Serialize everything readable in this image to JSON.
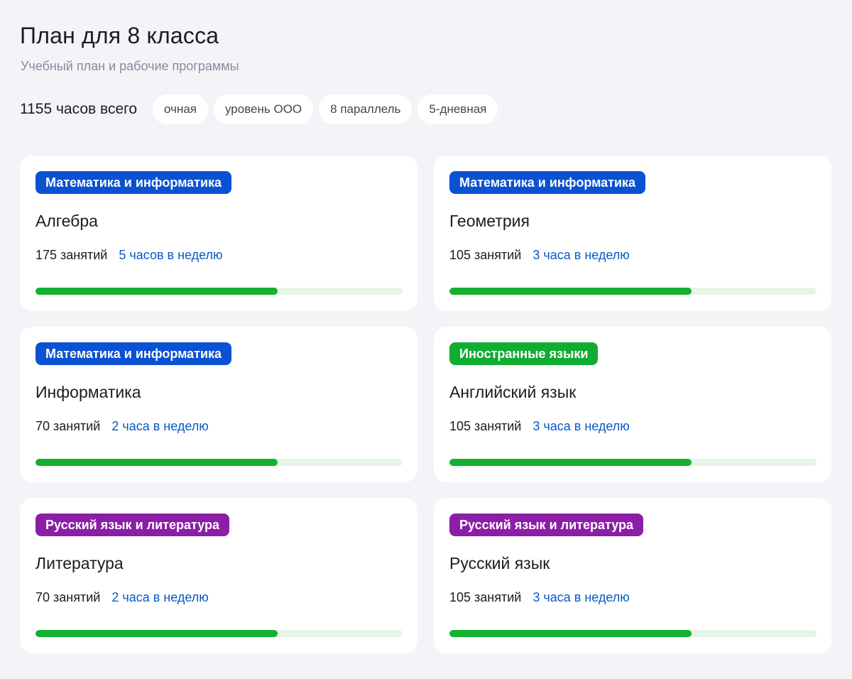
{
  "header": {
    "title": "План для 8 класса",
    "subtitle": "Учебный план и рабочие программы"
  },
  "summary": {
    "total_hours": "1155 часов всего",
    "chips": [
      "очная",
      "уровень ООО",
      "8 параллель",
      "5-дневная"
    ]
  },
  "colors": {
    "math": "#0a52d1",
    "languages": "#10ad32",
    "russian": "#8b1ea6",
    "progress": "#12b12f"
  },
  "subjects": [
    {
      "category": "Математика и информатика",
      "category_color": "#0a52d1",
      "name": "Алгебра",
      "lessons": "175 занятий",
      "weekly": "5 часов в неделю",
      "progress": 0.66
    },
    {
      "category": "Математика и информатика",
      "category_color": "#0a52d1",
      "name": "Геометрия",
      "lessons": "105 занятий",
      "weekly": "3 часа в неделю",
      "progress": 0.66
    },
    {
      "category": "Математика и информатика",
      "category_color": "#0a52d1",
      "name": "Информатика",
      "lessons": "70 занятий",
      "weekly": "2 часа в неделю",
      "progress": 0.66
    },
    {
      "category": "Иностранные языки",
      "category_color": "#10ad32",
      "name": "Английский язык",
      "lessons": "105 занятий",
      "weekly": "3 часа в неделю",
      "progress": 0.66
    },
    {
      "category": "Русский язык и литература",
      "category_color": "#8b1ea6",
      "name": "Литература",
      "lessons": "70 занятий",
      "weekly": "2 часа в неделю",
      "progress": 0.66
    },
    {
      "category": "Русский язык и литература",
      "category_color": "#8b1ea6",
      "name": "Русский язык",
      "lessons": "105 занятий",
      "weekly": "3 часа в неделю",
      "progress": 0.66
    }
  ]
}
